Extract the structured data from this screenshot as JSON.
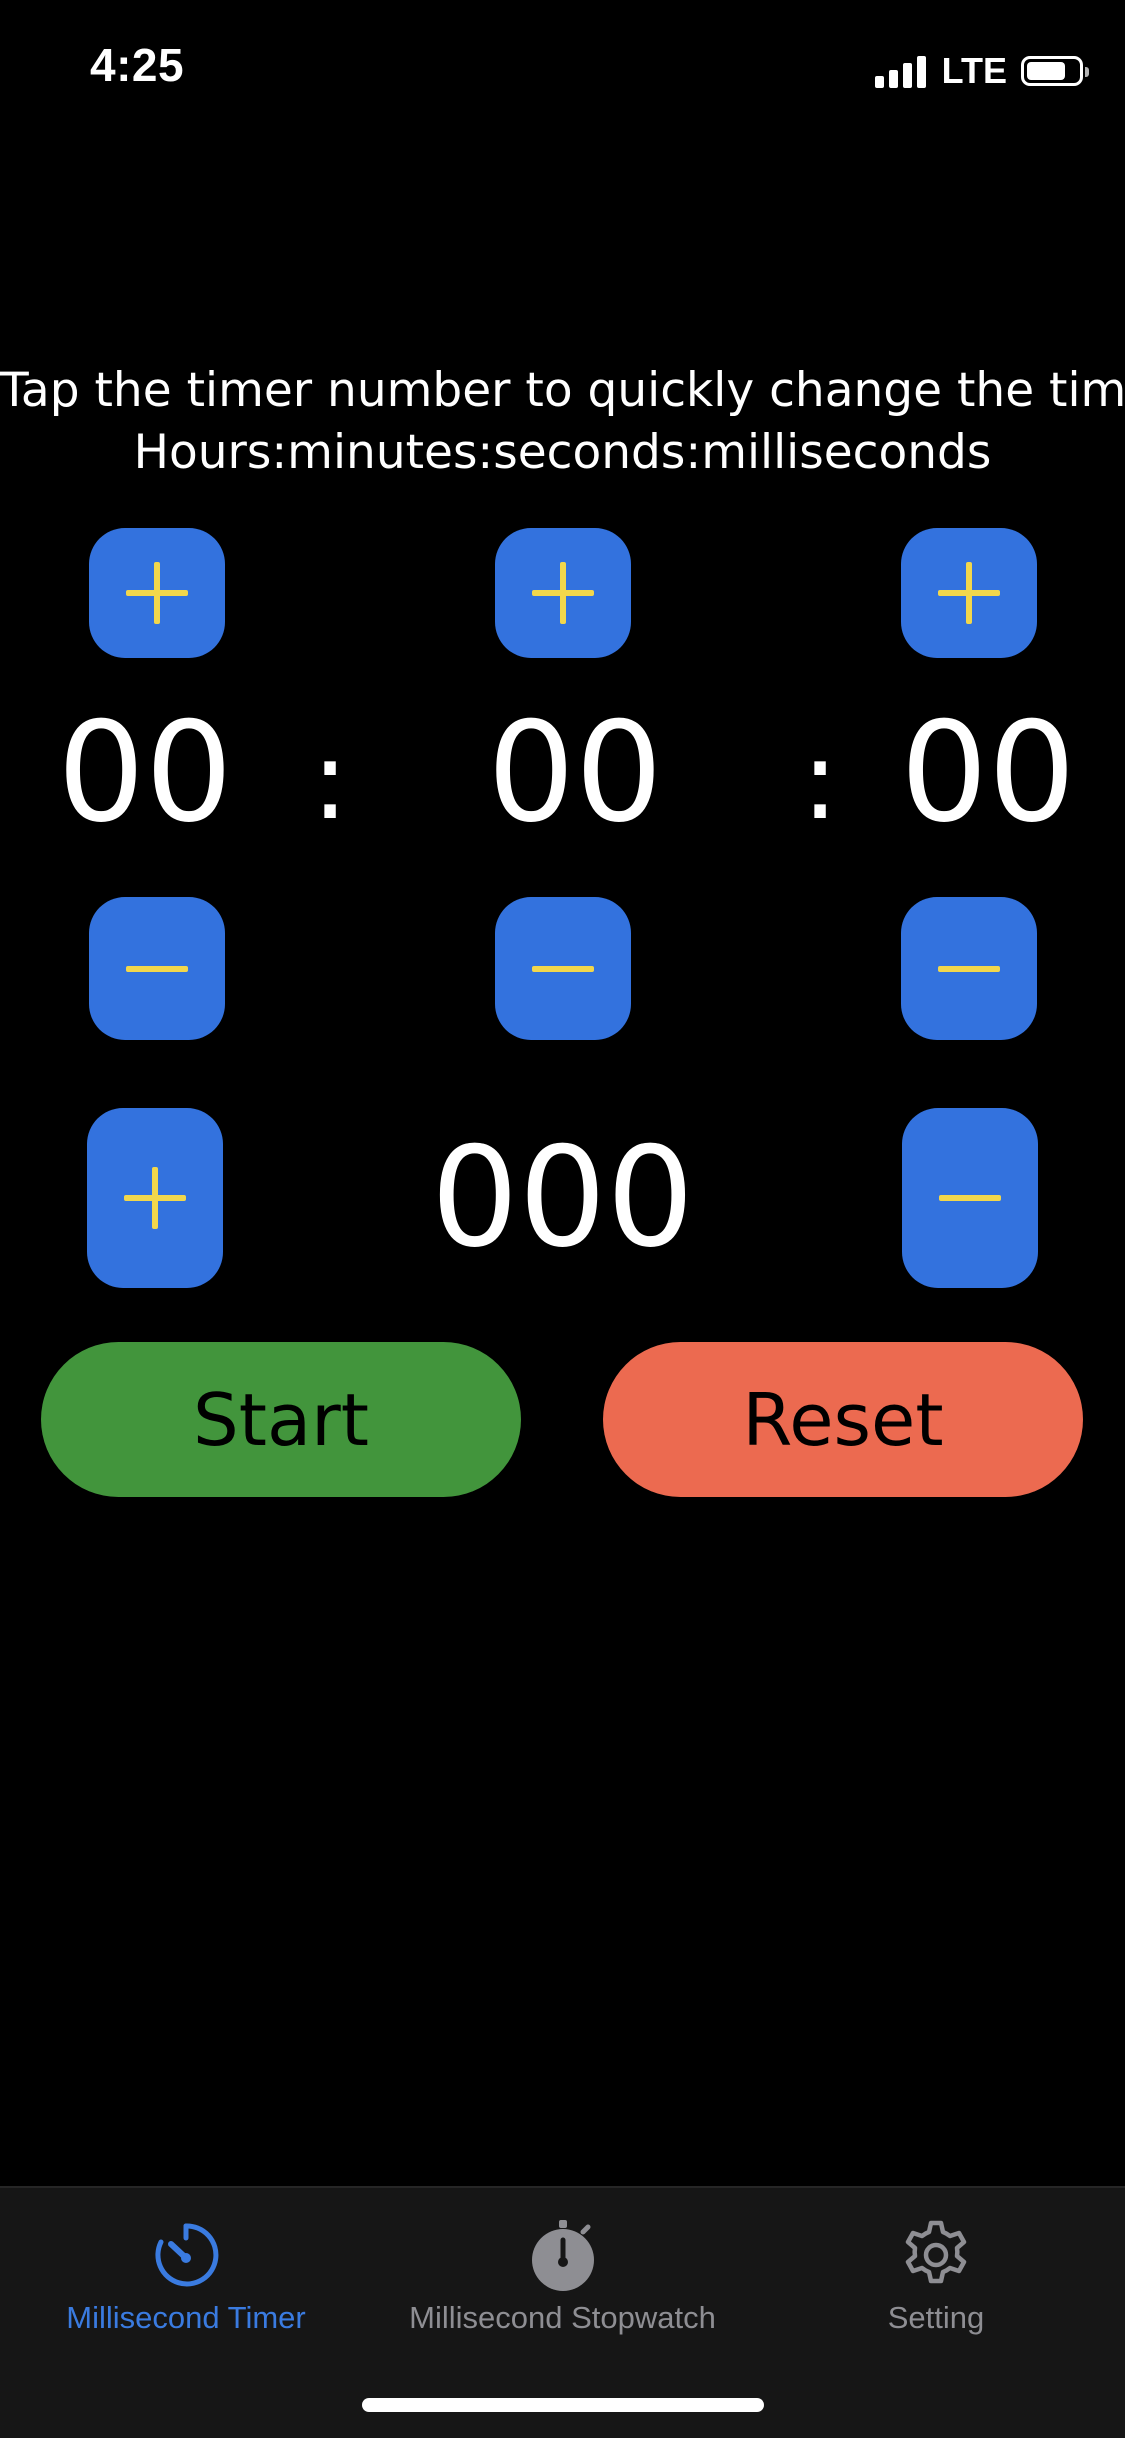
{
  "status_bar": {
    "time": "4:25",
    "network": "LTE",
    "battery_level": 0.75
  },
  "instructions": {
    "line1": "Tap the timer number to quickly change the time.",
    "line2": "Hours:minutes:seconds:milliseconds"
  },
  "timer": {
    "hours": "00",
    "minutes": "00",
    "seconds": "00",
    "milliseconds": "000",
    "separator": ":"
  },
  "actions": {
    "start_label": "Start",
    "reset_label": "Reset"
  },
  "tab_bar": {
    "tabs": [
      {
        "label": "Millisecond Timer",
        "icon": "timer-icon",
        "active": true
      },
      {
        "label": "Millisecond Stopwatch",
        "icon": "stopwatch-icon",
        "active": false
      },
      {
        "label": "Setting",
        "icon": "gear-icon",
        "active": false
      }
    ]
  },
  "colors": {
    "step_button": "#3372de",
    "step_glyph": "#f2d74c",
    "start_button": "#42953c",
    "reset_button": "#ec6a50",
    "tab_active": "#3a7be0",
    "tab_inactive": "#8e8e93"
  }
}
